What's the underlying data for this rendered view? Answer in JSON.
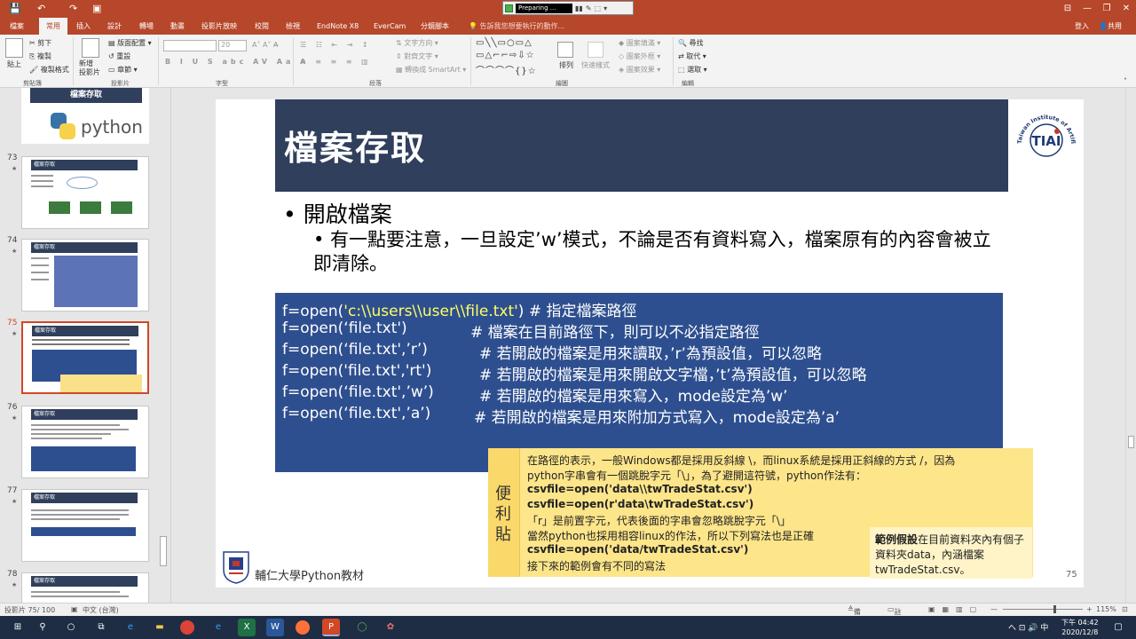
{
  "quick_access": {
    "save": "💾",
    "undo": "↶",
    "redo": "↷",
    "present": "▣"
  },
  "recorder": {
    "status": "Preparing ..."
  },
  "tabs": [
    "檔案",
    "常用",
    "插入",
    "設計",
    "轉場",
    "動畫",
    "投影片放映",
    "校閱",
    "檢視",
    "EndNote X8",
    "EverCam",
    "分鏡腳本"
  ],
  "tellme": "告訴我您想要執行的動作...",
  "login": "登入",
  "share": "共用",
  "ribbon": {
    "paste": "貼上",
    "cut": "剪下",
    "copy": "複製",
    "format_painter": "複製格式",
    "clipboard": "剪貼簿",
    "new_slide": "新增\n投影片",
    "layout": "版面配置",
    "reset": "重設",
    "section": "章節",
    "slides": "投影片",
    "font_group": "字型",
    "font_size": "20",
    "para_group": "段落",
    "text_dir": "文字方向",
    "align_text": "對齊文字",
    "smartart": "轉換成 SmartArt",
    "drawing_group": "繪圖",
    "arrange": "排列",
    "quick_styles": "快速樣式",
    "fill": "圖案填滿",
    "outline": "圖案外框",
    "effects": "圖案效果",
    "find": "尋找",
    "replace": "取代",
    "select": "選取",
    "edit_group": "編輯"
  },
  "thumbs": [
    {
      "num": "73",
      "title": "檔案存取"
    },
    {
      "num": "74",
      "title": "檔案存取"
    },
    {
      "num": "75",
      "title": "檔案存取"
    },
    {
      "num": "76",
      "title": "檔案存取"
    },
    {
      "num": "77",
      "title": "檔案存取"
    },
    {
      "num": "78",
      "title": "檔案存取"
    }
  ],
  "top_thumb": {
    "title": "檔案存取",
    "logo": "python"
  },
  "slide": {
    "title": "檔案存取",
    "bullet1": "• 開啟檔案",
    "bullet2": "• 有一點要注意，一旦設定’w’模式，不論是否有資料寫入，檔案原有的內容會被立即清除。",
    "logo_text": "Taiwan Institute of Artificial Intelligence",
    "logo_mark": "TIAI",
    "footer": "輔仁大學Python教材",
    "page": "75"
  },
  "code": [
    {
      "pre": "f=open(",
      "str": "'c:\\\\users\\\\user\\\\file.txt'",
      "post": ")",
      "comment": "# 指定檔案路徑"
    },
    {
      "pre": "f=open(‘file.txt')",
      "str": "",
      "post": "",
      "comment": "# 檔案在目前路徑下，則可以不必指定路徑"
    },
    {
      "pre": "f=open(‘file.txt',’r’)",
      "str": "",
      "post": "",
      "comment": "# 若開啟的檔案是用來讀取，’r’為預設值，可以忽略"
    },
    {
      "pre": "f=open('file.txt','rt')",
      "str": "",
      "post": "",
      "comment": "# 若開啟的檔案是用來開啟文字檔，’t’為預設值，可以忽略"
    },
    {
      "pre": "f=open(‘file.txt',’w’)",
      "str": "",
      "post": "",
      "comment": "# 若開啟的檔案是用來寫入，mode設定為’w’"
    },
    {
      "pre": "f=open(‘file.txt',’a’)",
      "str": "",
      "post": "",
      "comment": "# 若開啟的檔案是用來附加方式寫入，mode設定為’a’"
    }
  ],
  "sticky": {
    "label": "便利貼",
    "lines": [
      {
        "text": "在路徑的表示，一般Windows都是採用反斜線 \\，而linux系統是採用正斜線的方式 /，因為",
        "bold": false
      },
      {
        "text": "python字串會有一個跳脫字元「\\」，為了避開這符號，python作法有：",
        "bold": false
      },
      {
        "text": "csvfile=open('data\\\\twTradeStat.csv')",
        "bold": true
      },
      {
        "text": "csvfile=open(r'data\\twTradeStat.csv')",
        "bold": true
      },
      {
        "text": "「r」是前置字元，代表後面的字串會忽略跳脫字元「\\」",
        "bold": false
      },
      {
        "text": "當然python也採用相容linux的作法，所以下列寫法也是正確",
        "bold": false
      },
      {
        "text": "csvfile=open('data/twTradeStat.csv')",
        "bold": true
      },
      {
        "text": "接下來的範例會有不同的寫法",
        "bold": false
      }
    ],
    "note_bold": "範例假設",
    "note_rest": "在目前資料夾內有個子資料夾data，內涵檔案twTradeStat.csv。"
  },
  "status": {
    "slide_info": "投影片 75/ 100",
    "lang": "中文 (台灣)",
    "notes": "備忘稿",
    "comments": "註解",
    "zoom": "115%"
  },
  "taskbar": {
    "time": "下午 04:42",
    "date": "2020/12/8",
    "ime": "中",
    "tray": "へ ⊡ 🔊"
  },
  "colors": {
    "ppt_red": "#b7472a",
    "banner": "#2f3f5c",
    "code_bg": "#2e4f8f",
    "sticky": "#fde58a"
  }
}
